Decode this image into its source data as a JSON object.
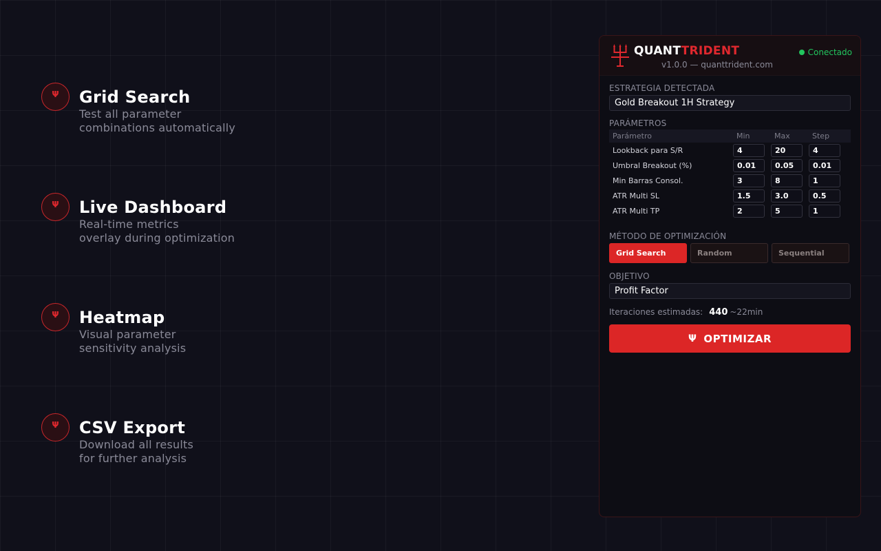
{
  "features": [
    {
      "icon": "Ψ",
      "title": "Grid Search",
      "desc_line1": "Test all parameter",
      "desc_line2": "combinations automatically"
    },
    {
      "icon": "Ψ",
      "title": "Live Dashboard",
      "desc_line1": "Real-time metrics",
      "desc_line2": "overlay during optimization"
    },
    {
      "icon": "Ψ",
      "title": "Heatmap",
      "desc_line1": "Visual parameter",
      "desc_line2": "sensitivity analysis"
    },
    {
      "icon": "Ψ",
      "title": "CSV Export",
      "desc_line1": "Download all results",
      "desc_line2": "for further analysis"
    }
  ],
  "header": {
    "brand_part1": "QUANT",
    "brand_part2": "TRIDENT",
    "version": "v1.0.0 — quanttrident.com",
    "status": "Conectado",
    "logo_icon": "trident-icon"
  },
  "strategy": {
    "label": "ESTRATEGIA DETECTADA",
    "value": "Gold Breakout 1H Strategy"
  },
  "params": {
    "label": "PARÁMETROS",
    "headers": [
      "Parámetro",
      "Min",
      "Max",
      "Step"
    ],
    "rows": [
      {
        "name": "Lookback para S/R",
        "min": "4",
        "max": "20",
        "step": "4"
      },
      {
        "name": "Umbral Breakout (%)",
        "min": "0.01",
        "max": "0.05",
        "step": "0.01"
      },
      {
        "name": "Min Barras Consol.",
        "min": "3",
        "max": "8",
        "step": "1"
      },
      {
        "name": "ATR Multi SL",
        "min": "1.5",
        "max": "3.0",
        "step": "0.5"
      },
      {
        "name": "ATR Multi TP",
        "min": "2",
        "max": "5",
        "step": "1"
      }
    ]
  },
  "method": {
    "label": "MÉTODO DE OPTIMIZACIÓN",
    "options": [
      "Grid Search",
      "Random",
      "Sequential"
    ],
    "selected": "Grid Search"
  },
  "objective": {
    "label": "OBJETIVO",
    "value": "Profit Factor"
  },
  "iterations": {
    "label": "Iteraciones estimadas:",
    "count": "440",
    "time": "~22min"
  },
  "optimize_button": {
    "icon": "Ψ",
    "label": "OPTIMIZAR"
  },
  "colors": {
    "accent": "#dc2626",
    "status": "#22c55e",
    "background": "#10101a"
  }
}
